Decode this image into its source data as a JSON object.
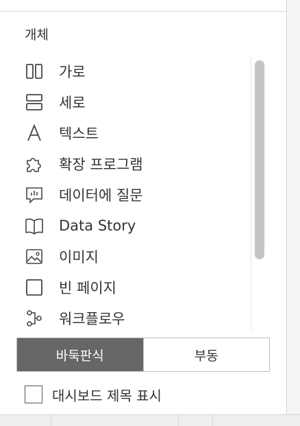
{
  "section_title": "개체",
  "objects": [
    {
      "label": "가로",
      "icon": "horizontal-container-icon"
    },
    {
      "label": "세로",
      "icon": "vertical-container-icon"
    },
    {
      "label": "텍스트",
      "icon": "text-icon"
    },
    {
      "label": "확장 프로그램",
      "icon": "extension-puzzle-icon"
    },
    {
      "label": "데이터에 질문",
      "icon": "ask-data-icon"
    },
    {
      "label": "Data Story",
      "icon": "data-story-book-icon"
    },
    {
      "label": "이미지",
      "icon": "image-icon"
    },
    {
      "label": "빈 페이지",
      "icon": "blank-icon"
    },
    {
      "label": "워크플로우",
      "icon": "workflow-icon"
    }
  ],
  "layout_toggle": {
    "tiled_label": "바둑판식",
    "floating_label": "부동",
    "selected": "tiled"
  },
  "show_title": {
    "label": "대시보드 제목 표시",
    "checked": false
  },
  "colors": {
    "toggle_active_bg": "#666666",
    "scrollbar_thumb": "#c4c4c4"
  }
}
